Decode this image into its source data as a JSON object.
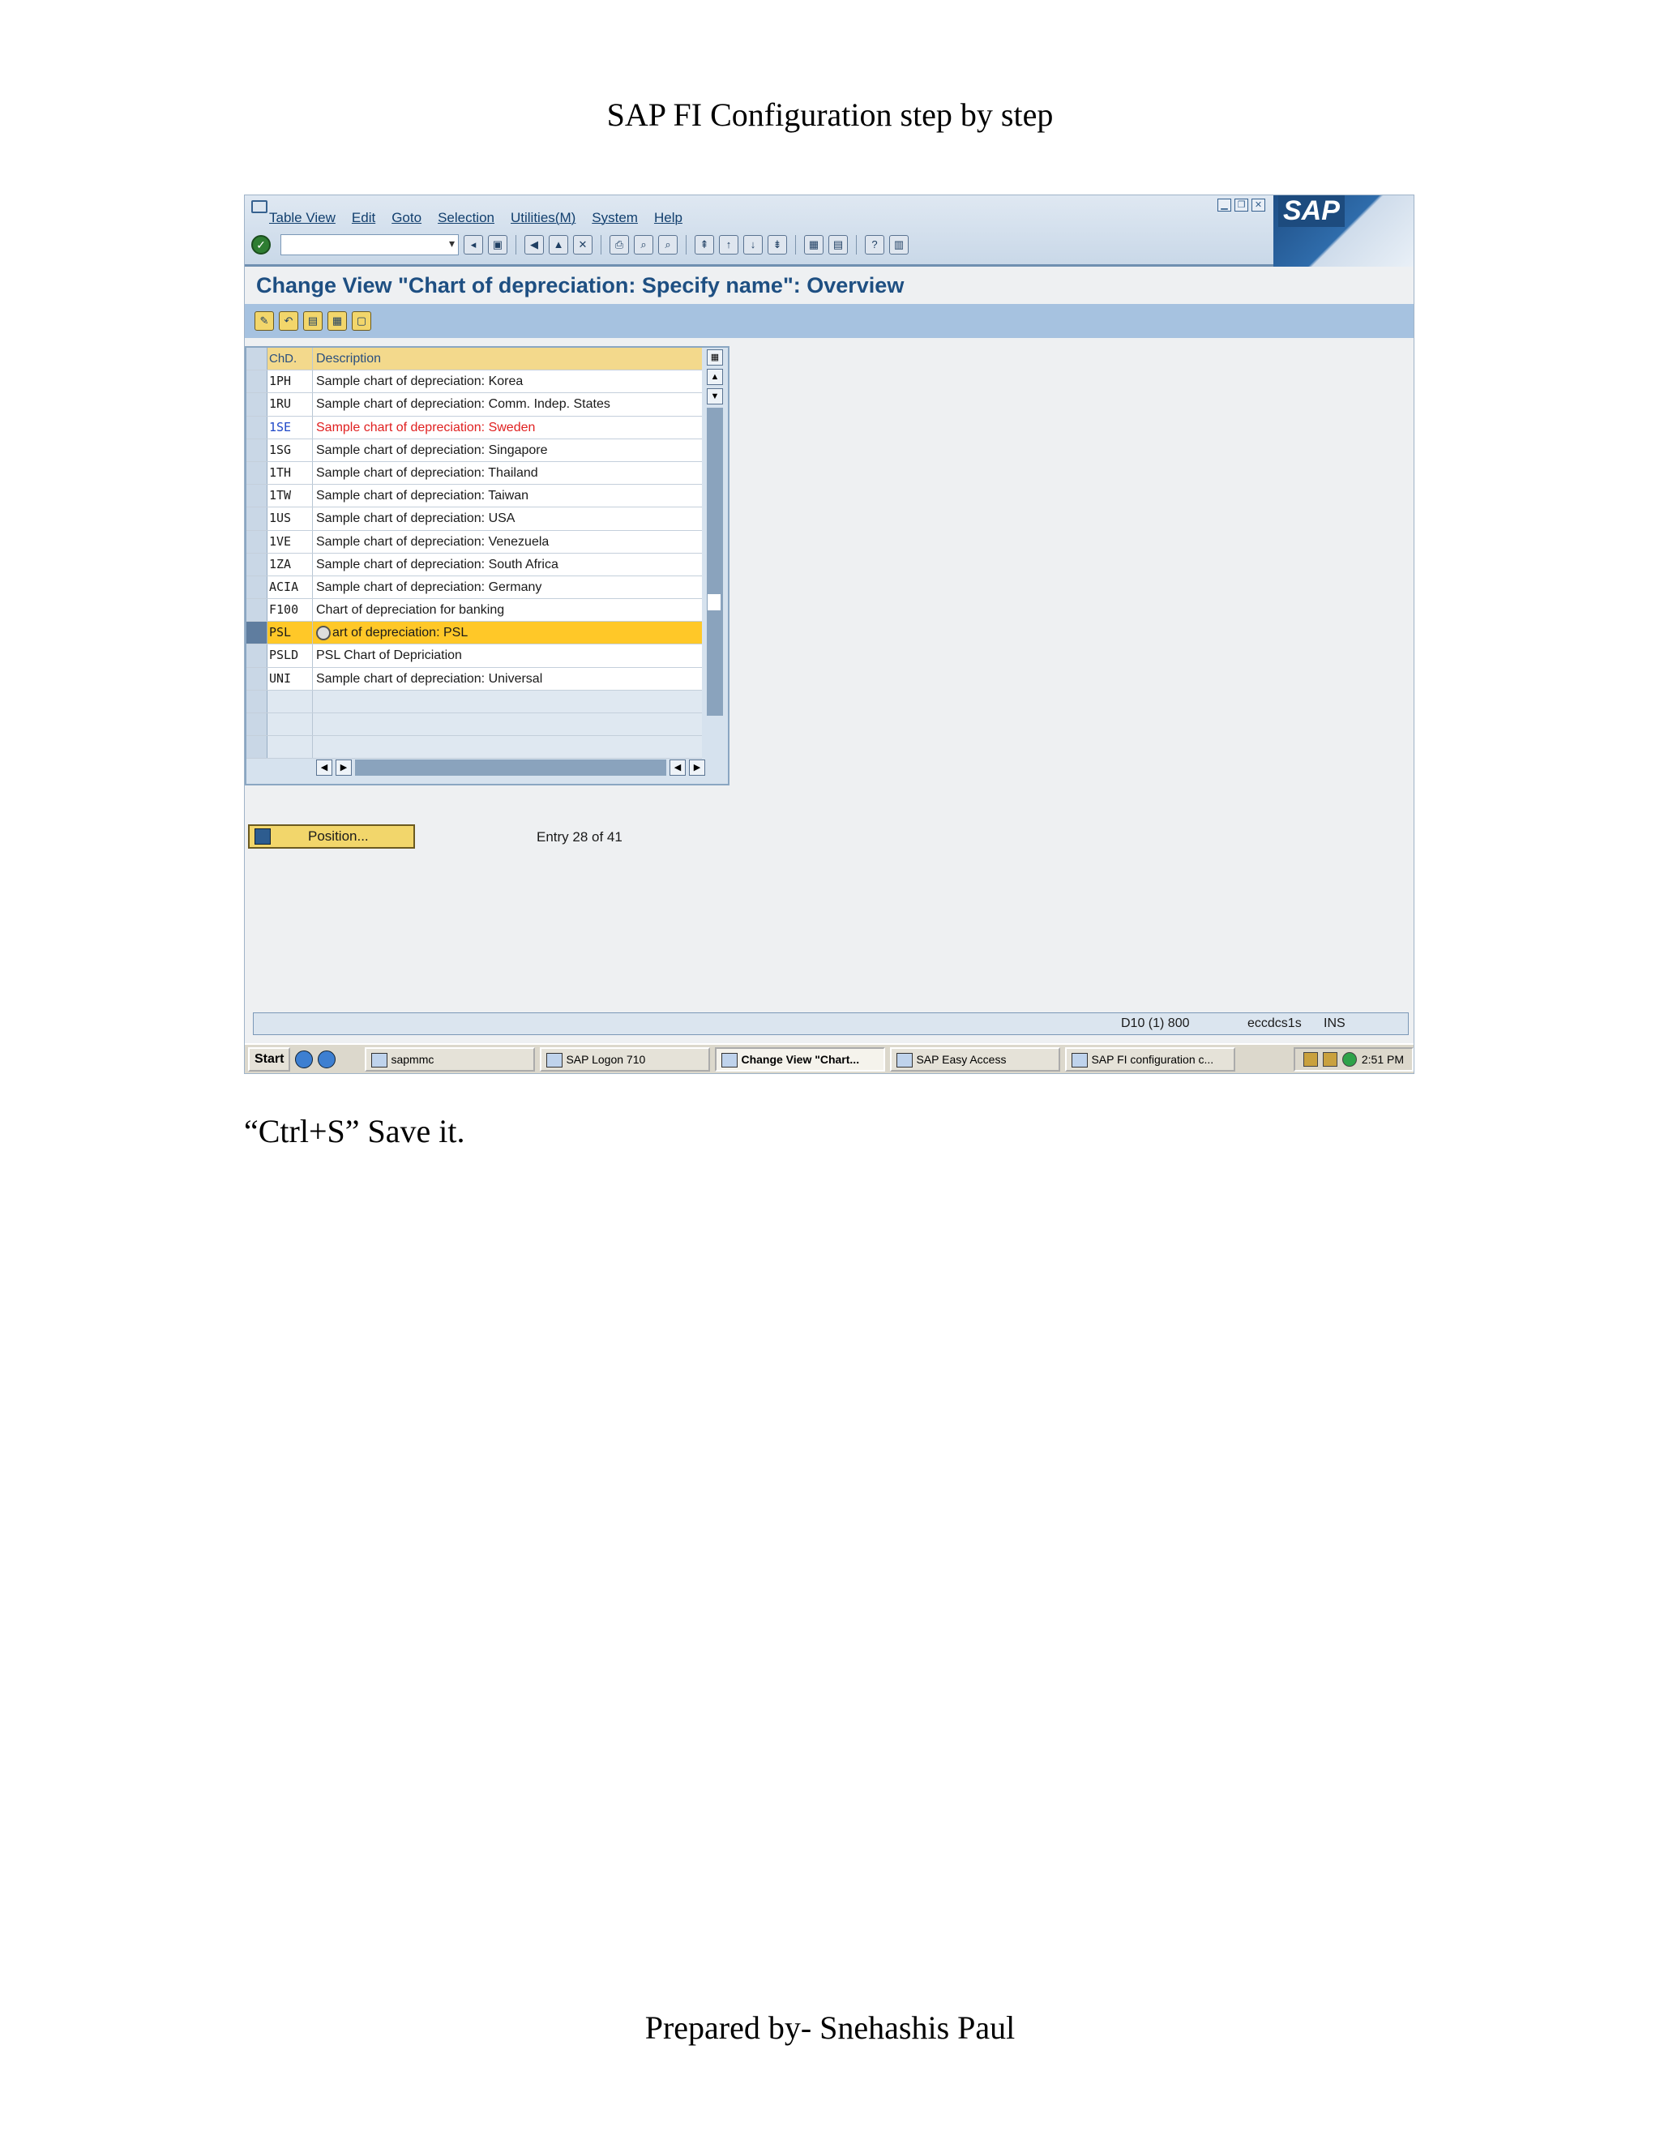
{
  "document": {
    "header": "SAP FI Configuration step by step",
    "note": "“Ctrl+S” Save it.",
    "footer": "Prepared by- Snehashis Paul"
  },
  "sap": {
    "menu": [
      "Table View",
      "Edit",
      "Goto",
      "Selection",
      "Utilities(M)",
      "System",
      "Help"
    ],
    "logo_text": "SAP",
    "screen_title": "Change View \"Chart of depreciation: Specify name\": Overview",
    "table": {
      "headers": {
        "chd": "ChD.",
        "description": "Description"
      },
      "rows": [
        {
          "chd": "1PH",
          "description": "Sample chart of depreciation: Korea"
        },
        {
          "chd": "1RU",
          "description": "Sample chart of depreciation: Comm. Indep. States"
        },
        {
          "chd": "1SE",
          "description": "Sample chart of depreciation: Sweden"
        },
        {
          "chd": "1SG",
          "description": "Sample chart of depreciation: Singapore"
        },
        {
          "chd": "1TH",
          "description": "Sample chart of depreciation: Thailand"
        },
        {
          "chd": "1TW",
          "description": "Sample chart of depreciation: Taiwan"
        },
        {
          "chd": "1US",
          "description": "Sample chart of depreciation: USA"
        },
        {
          "chd": "1VE",
          "description": "Sample chart of depreciation: Venezuela"
        },
        {
          "chd": "1ZA",
          "description": "Sample chart of depreciation: South Africa"
        },
        {
          "chd": "ACIA",
          "description": "Sample chart of depreciation: Germany"
        },
        {
          "chd": "F100",
          "description": "Chart of depreciation for banking"
        },
        {
          "chd": "PSL",
          "description": "art of depreciation: PSL"
        },
        {
          "chd": "PSLD",
          "description": "PSL Chart of Depriciation"
        },
        {
          "chd": "UNI",
          "description": "Sample chart of depreciation: Universal"
        }
      ]
    },
    "position_button": "Position...",
    "entry_info": "Entry 28 of 41",
    "status": {
      "system": "D10 (1) 800",
      "server": "eccdcs1s",
      "mode": "INS"
    },
    "taskbar": {
      "start": "Start",
      "tasks": [
        "sapmmc",
        "SAP Logon 710",
        "Change View \"Chart...",
        "SAP Easy Access",
        "SAP FI configuration c..."
      ],
      "clock": "2:51 PM"
    }
  }
}
